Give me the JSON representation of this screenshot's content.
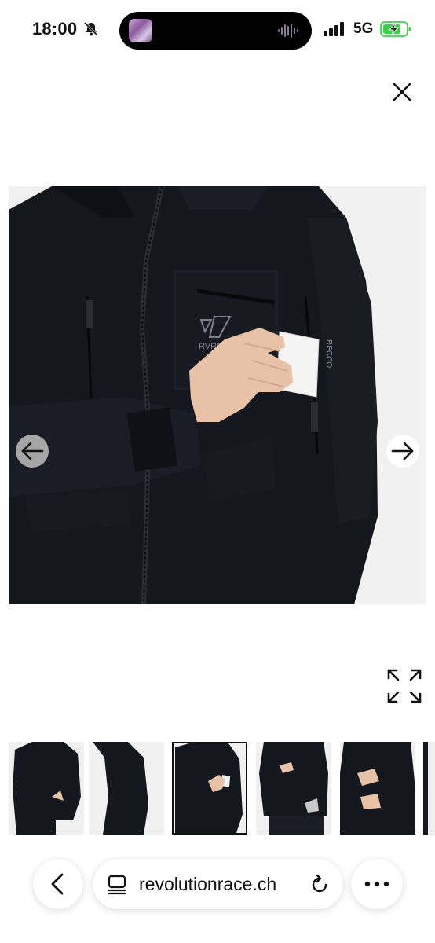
{
  "status_bar": {
    "time": "18:00",
    "network": "5G",
    "icons": [
      "bell-muted-icon",
      "signal-bars-icon",
      "battery-charging-icon"
    ],
    "battery_color": "#3ecf4a"
  },
  "overlay": {
    "close_icon": "close-icon"
  },
  "gallery": {
    "main_image_alt": "",
    "brand_mark": "RVRC",
    "pocket_label": "RECCO",
    "prev_icon": "arrow-left-icon",
    "next_icon": "arrow-right-icon",
    "expand_icon": "expand-icon",
    "thumbnails_count": 5,
    "selected_thumbnail": 3
  },
  "browser_bar": {
    "url": "revolutionrace.ch",
    "back_icon": "chevron-left-icon",
    "tabs_icon": "tabs-icon",
    "reload_icon": "reload-icon",
    "more_icon": "more-dots-icon"
  },
  "colors": {
    "jacket": "#15171f",
    "background": "#f1f1f2",
    "skin": "#e8c2a6"
  }
}
